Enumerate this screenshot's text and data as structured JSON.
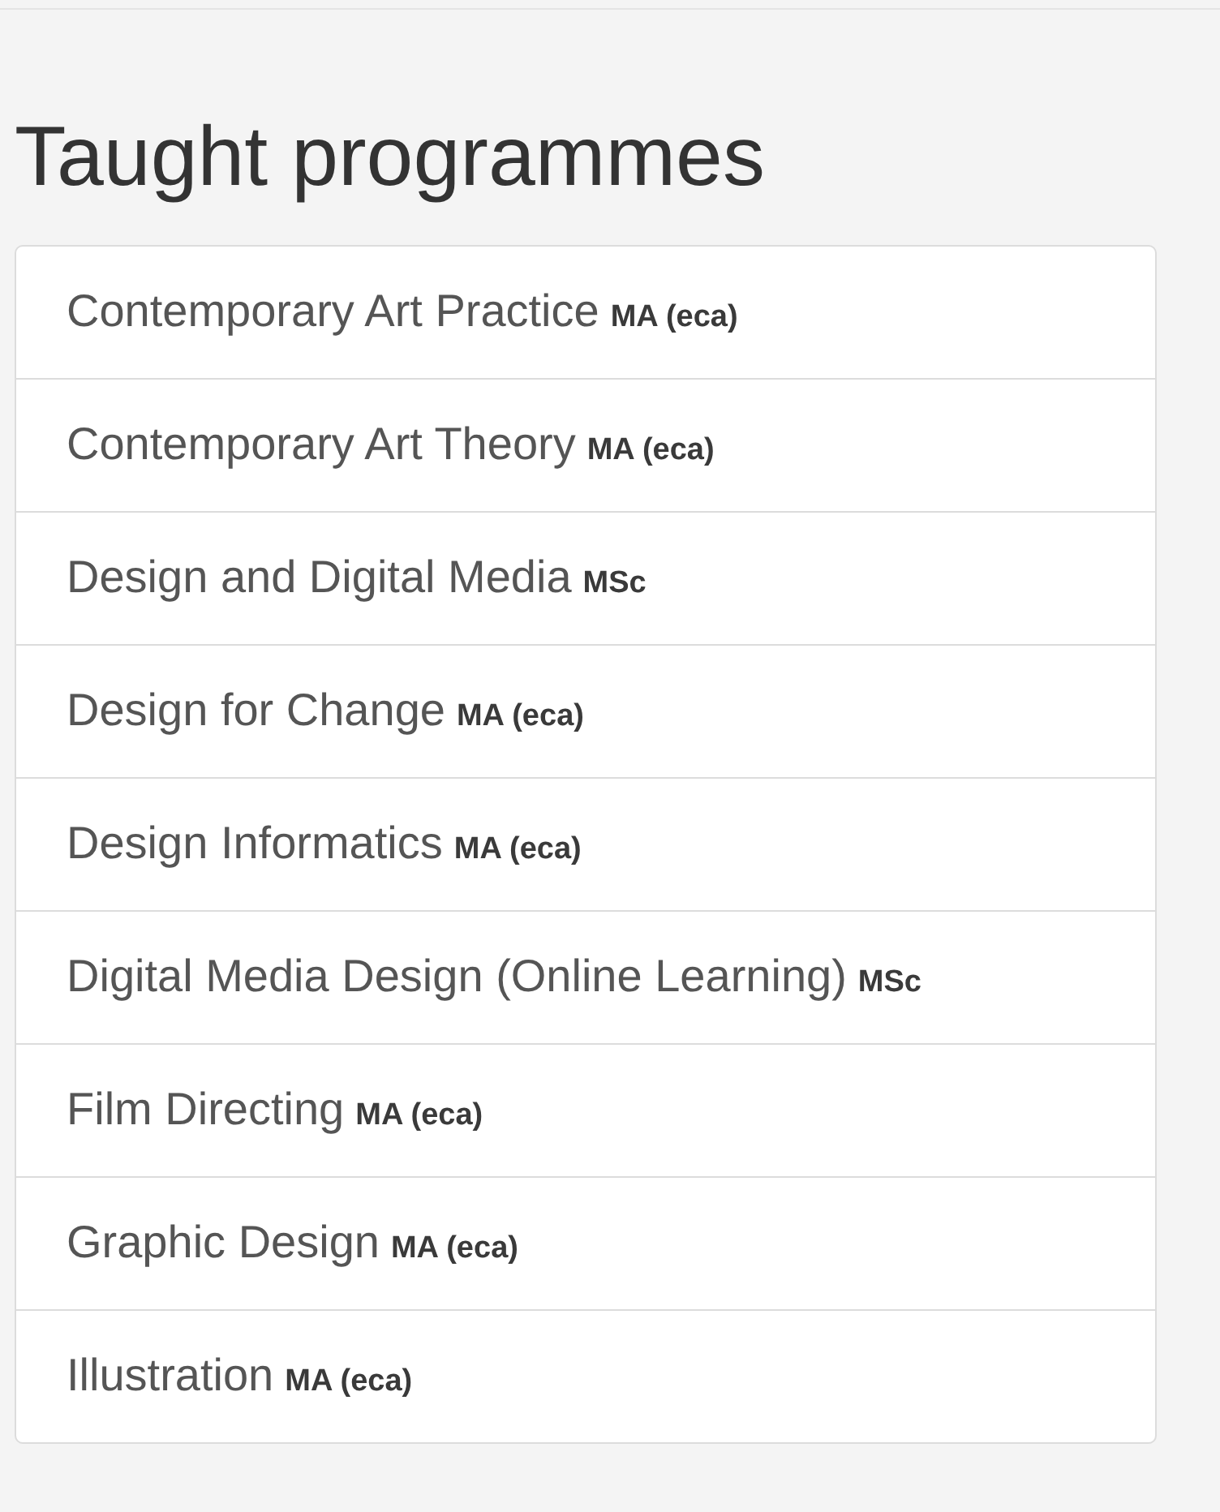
{
  "heading": "Taught programmes",
  "programmes": [
    {
      "title": "Contemporary Art Practice",
      "award": "MA (eca)"
    },
    {
      "title": "Contemporary Art Theory",
      "award": "MA (eca)"
    },
    {
      "title": "Design and Digital Media",
      "award": "MSc"
    },
    {
      "title": "Design for Change",
      "award": "MA (eca)"
    },
    {
      "title": "Design Informatics",
      "award": "MA (eca)"
    },
    {
      "title": "Digital Media Design (Online Learning)",
      "award": "MSc"
    },
    {
      "title": "Film Directing",
      "award": "MA (eca)"
    },
    {
      "title": "Graphic Design",
      "award": "MA (eca)"
    },
    {
      "title": "Illustration",
      "award": "MA (eca)"
    }
  ]
}
